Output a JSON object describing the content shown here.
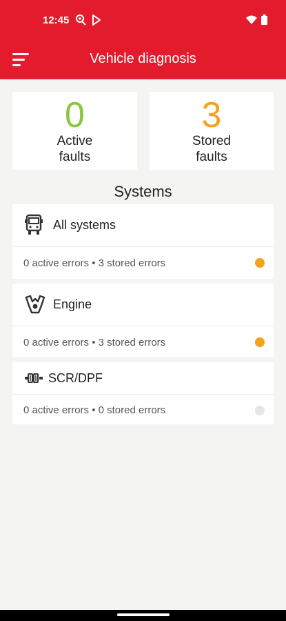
{
  "status_bar": {
    "time": "12:45",
    "icons": [
      "location-icon",
      "play-store-icon",
      "wifi-icon",
      "battery-icon"
    ]
  },
  "app_bar": {
    "title": "Vehicle diagnosis",
    "menu_icon": "menu-icon",
    "color": "#e31b2d"
  },
  "counters": {
    "active": {
      "value": "0",
      "label_line1": "Active",
      "label_line2": "faults",
      "color": "#8cc63f"
    },
    "stored": {
      "value": "3",
      "label_line1": "Stored",
      "label_line2": "faults",
      "color": "#f5a31a"
    }
  },
  "systems": {
    "title": "Systems",
    "items": [
      {
        "name": "All systems",
        "icon": "truck-icon",
        "status": "0 active errors • 3 stored errors",
        "dot_color": "#f5a31a"
      },
      {
        "name": "Engine",
        "icon": "engine-icon",
        "status": "0 active errors • 3 stored errors",
        "dot_color": "#f5a31a"
      },
      {
        "name": "SCR/DPF",
        "icon": "exhaust-filter-icon",
        "status": "0 active errors • 0 stored errors",
        "dot_color": "#e6e6e6"
      }
    ]
  }
}
